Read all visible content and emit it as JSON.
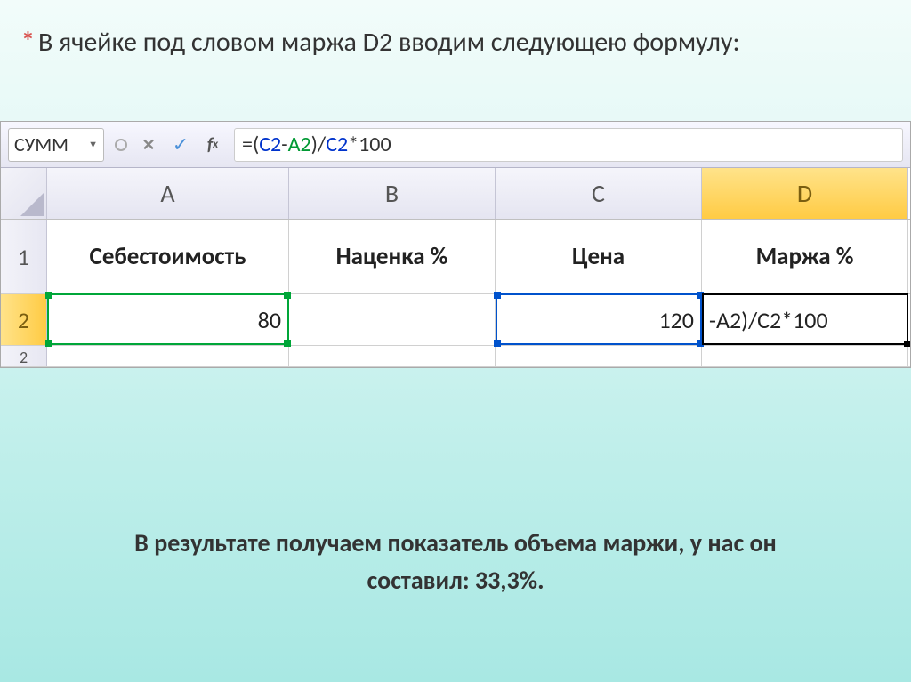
{
  "slide": {
    "top_text": "В ячейке под словом маржа D2 вводим следующею формулу:",
    "bottom_text_line1": "В результате получаем показатель объема маржи, у нас он",
    "bottom_text_line2": "составил: 33,3%.",
    "asterisk": "*"
  },
  "formula_bar": {
    "name_box": "СУММ",
    "formula_parts": {
      "full": "=(C2-A2)/C2*100"
    }
  },
  "columns": [
    "A",
    "B",
    "C",
    "D"
  ],
  "rows": {
    "r1": {
      "num": "1",
      "A": "Себестоимость",
      "B": "Наценка %",
      "C": "Цена",
      "D": "Маржа %"
    },
    "r2": {
      "num": "2",
      "A": "80",
      "B": "",
      "C": "120",
      "D": "-A2)/C2*100"
    },
    "r3": {
      "num": "2"
    }
  },
  "chart_data": {
    "type": "table",
    "note": "Excel spreadsheet demonstrating margin % formula",
    "columns": [
      "Себестоимость",
      "Наценка %",
      "Цена",
      "Маржа %"
    ],
    "data_row": {
      "Себестоимость": 80,
      "Наценка %": null,
      "Цена": 120,
      "Маржа %": "=(C2-A2)/C2*100"
    },
    "computed_result_percent": 33.3
  }
}
